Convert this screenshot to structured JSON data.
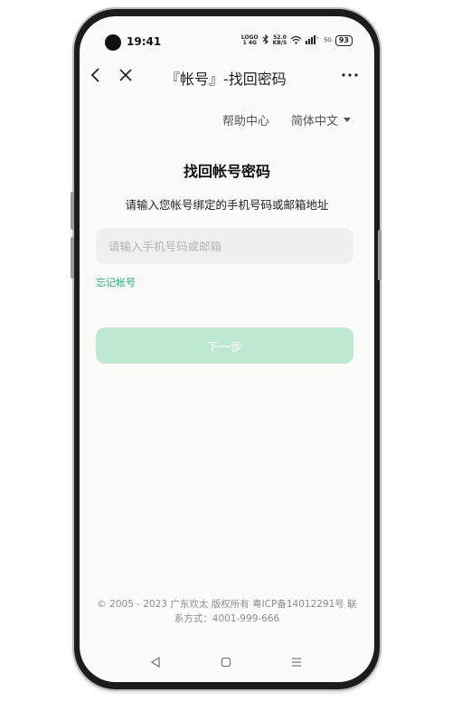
{
  "status_bar": {
    "time": "19:41",
    "network_label_top": "LOGO",
    "network_label_bottom": "1 4G",
    "bluetooth_icon": "bluetooth-icon",
    "speed_value": "52.0",
    "speed_unit": "KB/S",
    "wifi_icon": "wifi-icon",
    "signal_label": "5G",
    "battery": "93"
  },
  "nav": {
    "back_icon": "chevron-left-icon",
    "close_icon": "close-icon",
    "title": "『帐号』-找回密码",
    "more_icon": "more-icon"
  },
  "top_links": {
    "help": "帮助中心",
    "language": "简体中文"
  },
  "form": {
    "heading": "找回帐号密码",
    "subtitle": "请输入您帐号绑定的手机号码或邮箱地址",
    "input_placeholder": "请输入手机号码或邮箱",
    "input_value": "",
    "forgot_link": "忘记帐号",
    "next_button": "下一步"
  },
  "footer": {
    "copyright": "© 2005 - 2023 广东欢太 版权所有 粤ICP备14012291号 联系方式：4001-999-666"
  },
  "gesture_bar": {
    "back_icon": "triangle-back-icon",
    "home_icon": "square-home-icon",
    "menu_icon": "menu-lines-icon"
  },
  "colors": {
    "accent": "#1db470",
    "button_disabled": "#bde9d3",
    "screen_bg": "#fbfbf9",
    "input_bg": "#f0f0ee"
  }
}
